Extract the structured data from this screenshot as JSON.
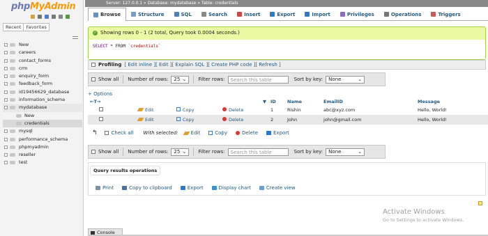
{
  "app": {
    "logo_php": "php",
    "logo_my": "MyAdmin"
  },
  "sidebar": {
    "tabs": [
      "Recent",
      "Favorites"
    ],
    "tree": [
      {
        "label": "New",
        "level": 0
      },
      {
        "label": "careers",
        "level": 0
      },
      {
        "label": "contact_forms",
        "level": 0
      },
      {
        "label": "crm",
        "level": 0
      },
      {
        "label": "enquiry_form",
        "level": 0
      },
      {
        "label": "feedback_form",
        "level": 0
      },
      {
        "label": "id19456629_database",
        "level": 0
      },
      {
        "label": "information_schema",
        "level": 0
      },
      {
        "label": "mydatabase",
        "level": 0
      },
      {
        "label": "New",
        "level": 1
      },
      {
        "label": "credentials",
        "level": 1
      },
      {
        "label": "mysql",
        "level": 0
      },
      {
        "label": "performance_schema",
        "level": 0
      },
      {
        "label": "phpmyadmin",
        "level": 0
      },
      {
        "label": "reseller",
        "level": 0
      },
      {
        "label": "test",
        "level": 0
      }
    ]
  },
  "breadcrumb": {
    "server": "Server: 127.0.0.1",
    "database": "Database: mydatabase",
    "table": "Table: credentials"
  },
  "tabs": [
    {
      "label": "Browse",
      "icon": "browse-icon",
      "color": "#6b8fbf"
    },
    {
      "label": "Structure",
      "icon": "structure-icon",
      "color": "#7a9cc6"
    },
    {
      "label": "SQL",
      "icon": "sql-icon",
      "color": "#4e7fb0"
    },
    {
      "label": "Search",
      "icon": "search-icon",
      "color": "#888888"
    },
    {
      "label": "Insert",
      "icon": "insert-icon",
      "color": "#c94a4a"
    },
    {
      "label": "Export",
      "icon": "export-icon",
      "color": "#2c7ac9"
    },
    {
      "label": "Import",
      "icon": "import-icon",
      "color": "#2c7ac9"
    },
    {
      "label": "Privileges",
      "icon": "privileges-icon",
      "color": "#8a6fbf"
    },
    {
      "label": "Operations",
      "icon": "operations-icon",
      "color": "#777777"
    },
    {
      "label": "Triggers",
      "icon": "triggers-icon",
      "color": "#c95a5a"
    }
  ],
  "message": {
    "text": "Showing rows 0 - 1 (2 total, Query took 0.0004 seconds.)",
    "sql_keyword": "SELECT",
    "sql_rest": " * FROM ",
    "sql_table": "`credentials`"
  },
  "profiling": {
    "label": "Profiling",
    "links": [
      "[ Edit inline ]",
      "[ Edit ]",
      "[ Explain SQL ]",
      "[ Create PHP code ]",
      "[ Refresh ]"
    ]
  },
  "navbar": {
    "show_all": "Show all",
    "num_rows_label": "Number of rows:",
    "num_rows_value": "25",
    "filter_label": "Filter rows:",
    "filter_placeholder": "Search this table",
    "sort_label": "Sort by key:",
    "sort_value": "None"
  },
  "options_label": "+ Options",
  "table": {
    "nav_arrows": "←T→",
    "sort_arrow": "▼",
    "columns": [
      "ID",
      "Name",
      "EmailID",
      "Message"
    ],
    "action_labels": {
      "edit": "Edit",
      "copy": "Copy",
      "delete": "Delete"
    },
    "rows": [
      {
        "id": "1",
        "name": "Rishin",
        "email": "abc@xyz.com",
        "message": "Hello, World!"
      },
      {
        "id": "2",
        "name": "John",
        "email": "john@gmail.com",
        "message": "Hello, World!"
      }
    ]
  },
  "with_selected": {
    "check_all": "Check all",
    "label": "With selected:",
    "edit": "Edit",
    "copy": "Copy",
    "delete": "Delete",
    "export": "Export"
  },
  "query_ops": {
    "title": "Query results operations",
    "links": [
      "Print",
      "Copy to clipboard",
      "Export",
      "Display chart",
      "Create view"
    ]
  },
  "watermark": {
    "title": "Activate Windows",
    "subtitle": "Go to Settings to activate Windows."
  },
  "console": {
    "label": "Console"
  }
}
